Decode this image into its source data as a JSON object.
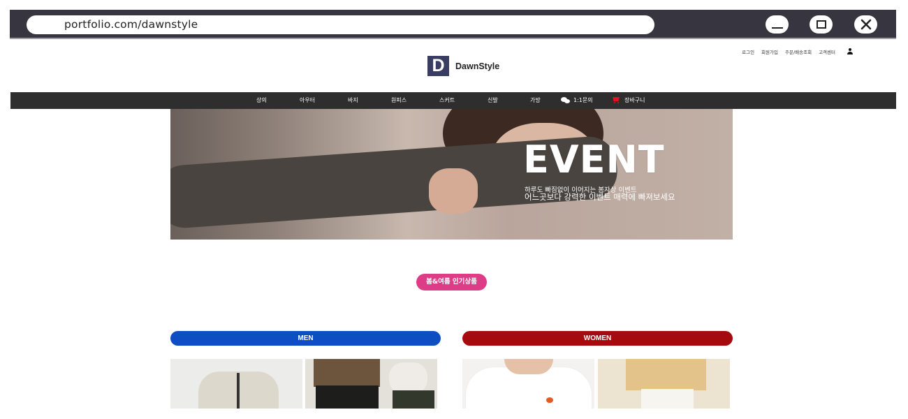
{
  "browser": {
    "url": "portfolio.com/dawnstyle",
    "icons": {
      "minimize": "minimize-icon",
      "maximize": "maximize-icon",
      "close": "close-icon"
    }
  },
  "util_links": [
    "로그인",
    "회원가입",
    "주문/배송조회",
    "고객센터"
  ],
  "logo": {
    "mark": "D",
    "name": "DawnStyle"
  },
  "nav": {
    "items": [
      "상의",
      "아우터",
      "바지",
      "원피스",
      "스커트",
      "신발",
      "가방"
    ],
    "inquiry": "1:1문의",
    "cart": "장바구니"
  },
  "banner": {
    "title": "EVENT",
    "subtitle1": "하루도 빠짐없이 이어지는 봄자상 이벤트",
    "subtitle2": "어느곳보다 강력한 이벤트 매력에 빠져보세요"
  },
  "popular_pill": "봄&여름 인기상품",
  "categories": {
    "men": "MEN",
    "women": "WOMEN"
  },
  "colors": {
    "chrome": "#373640",
    "nav": "#2e2e2e",
    "pill": "#dd3d87",
    "men": "#0d4fc3",
    "women": "#a50a0f",
    "cart": "#e1141e"
  }
}
